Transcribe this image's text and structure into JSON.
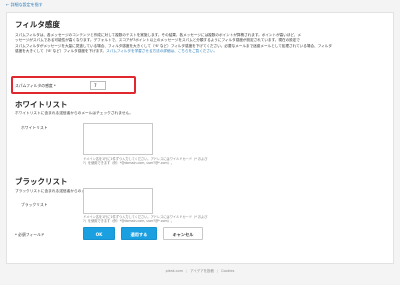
{
  "back_link": "← 詳細な設定を指す",
  "filter_threshold": {
    "title": "フィルタ感度",
    "desc_line1": "スパムフィルタは、各メッセージのコンテンツと作成に対して複数のテストを実施します。その結果、各メッセージには複数のポイントが算積されます。ポイントが高いほど、メ",
    "desc_line2": "ッセージがスパムである可能性が高くなります。デフォルトで、スコアが7ポイント以上のメッセージをスパムと分類するようにフィルタ感度が設定されています。現在の設定で",
    "desc_line3": "スパムフィルタがメッセージを大量に見逃している場合、フィルタ感度を大きくして（'6' など）フィルタ感度を下げてください。必要なメールまで迷惑メールとして処理されている場合、フィルタ",
    "desc_line4": "感度を大きくして（'8' など）フィルタ感度を下げます。",
    "desc_link": "スパムフィルタを学習させる方法の詳細は、こちらをご覧ください。",
    "field_label": "スパムフィルタの感度 *",
    "field_value": "7"
  },
  "whitelist": {
    "title": "ホワイトリスト",
    "desc": "ホワイトリストに含まれる送信者からのメールはチェックされません。",
    "field_label": "ホワイトリスト",
    "hint_line1": "ドメイン名を1行に1件ずつ入力してください。アドレスにはワイルドカード（* および",
    "hint_line2": "?）を使用できます（例：*@domain.com, user?@*.com）。"
  },
  "blacklist": {
    "title": "ブラックリスト",
    "desc": "ブラックリストに含まれる送信者からのメールはスパムとして分類されます。",
    "field_label": "ブラックリスト",
    "hint_line1": "ドメイン名を1行に1件ずつ入力してください。アドレスにはワイルドカード（* および",
    "hint_line2": "?）を使用できます（例：*@domain.com, user?@*.com）。"
  },
  "form": {
    "required_note": "* 必須フィールド",
    "ok_label": "OK",
    "apply_label": "適用する",
    "cancel_label": "キャンセル"
  },
  "footer": {
    "link1": "plesk.com",
    "link2": "アイデアを投稿",
    "link3": "Cookies"
  },
  "colors": {
    "accent": "#1aa0e0",
    "highlight": "#e0282e",
    "link": "#2a7ab8"
  }
}
